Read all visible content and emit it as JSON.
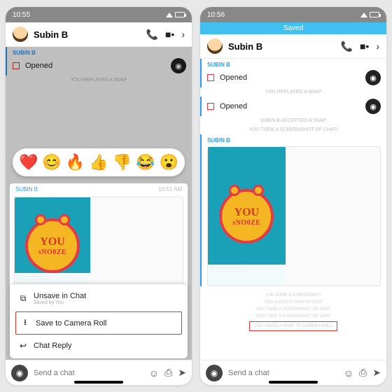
{
  "left": {
    "time": "10:55",
    "contact": "Subin B",
    "sender": "SUBIN B",
    "opened": "Opened",
    "sys1": "YOU REPLAYED A SNAP",
    "snap_sender": "SUBIN B",
    "snap_ts": "10:51 AM",
    "clock_t1": "YOU",
    "clock_t2": "sNO0ZE",
    "reactions": [
      "❤️",
      "😊",
      "🔥",
      "👍",
      "👎",
      "😂",
      "😮"
    ],
    "sheet": {
      "unsave": "Unsave in Chat",
      "unsave_sub": "Saved by You",
      "save": "Save to Camera Roll",
      "reply": "Chat Reply"
    },
    "placeholder": "Send a chat"
  },
  "right": {
    "time": "10:56",
    "banner": "Saved",
    "contact": "Subin B",
    "sender": "SUBIN B",
    "opened": "Opened",
    "sys1": "YOU REPLAYED A SNAP",
    "opened2": "Opened",
    "sys2a": "SUBIN B ACCEPTED A SNAP",
    "sys2b": "YOU TOOK A SCREENSHOT OF CHAT!",
    "snap_sender": "SUBIN B",
    "clock_t1": "YOU",
    "clock_t2": "sNO0ZE",
    "stack": [
      "YOU TOOK A SCREENSHOT",
      "YOU SAVED A SNAP IN CHAT",
      "YOU TOOK A SCREENSHOT OF CHAT",
      "YOU TOOK A SCREENSHOT OF CHAT"
    ],
    "stack_hl": "YOU SAVED A SNAP TO CAMERA ROLL",
    "placeholder": "Send a chat"
  }
}
